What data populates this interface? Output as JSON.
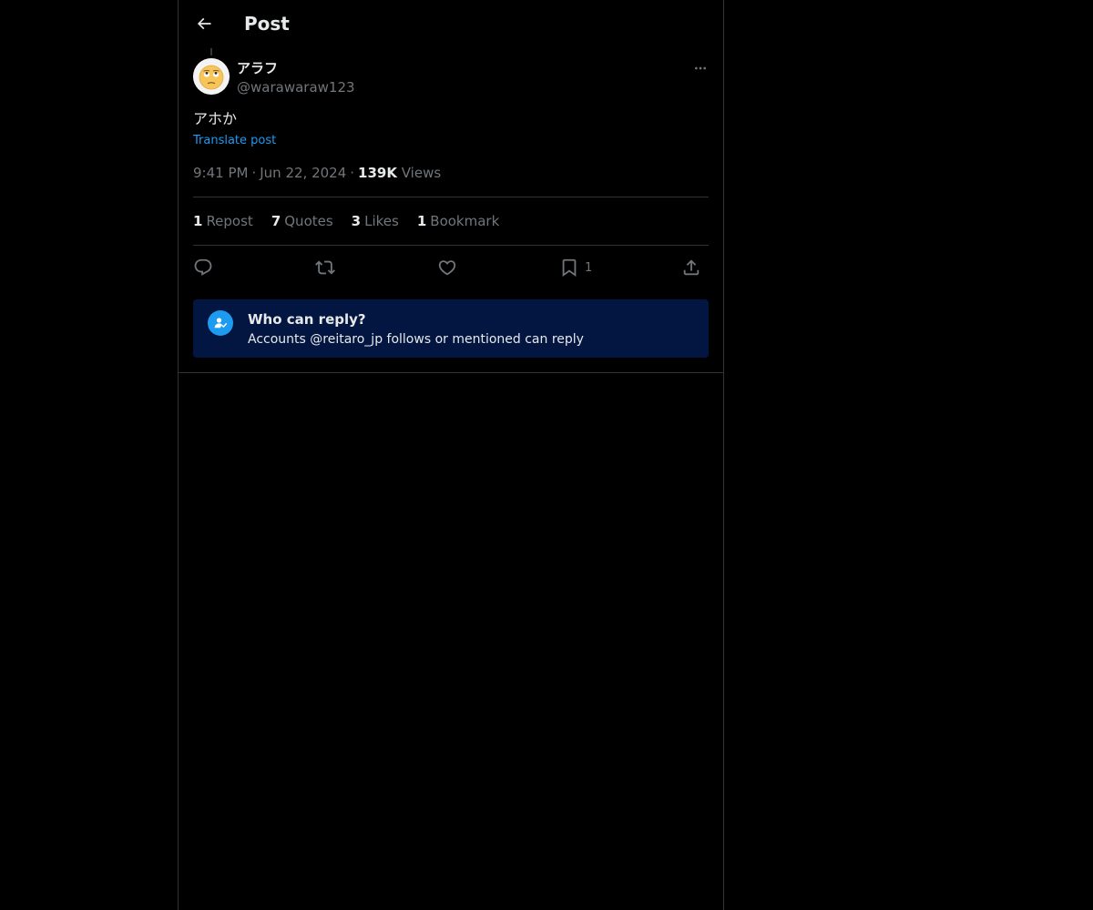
{
  "header": {
    "title": "Post"
  },
  "post": {
    "author": {
      "display_name": "アラフ",
      "handle": "@warawaraw123",
      "avatar_icon": "eye-roll-emoji"
    },
    "text": "アホか",
    "translate_label": "Translate post",
    "time": "9:41 PM",
    "date": "Jun 22, 2024",
    "views_count": "139K",
    "views_label": "Views",
    "separator": "·"
  },
  "stats": {
    "reposts": {
      "count": "1",
      "label": "Repost"
    },
    "quotes": {
      "count": "7",
      "label": "Quotes"
    },
    "likes": {
      "count": "3",
      "label": "Likes"
    },
    "bookmarks": {
      "count": "1",
      "label": "Bookmark"
    }
  },
  "actions": {
    "reply_icon": "reply-icon",
    "repost_icon": "repost-icon",
    "like_icon": "heart-icon",
    "bookmark_icon": "bookmark-icon",
    "bookmark_count": "1",
    "share_icon": "share-icon"
  },
  "reply_restriction": {
    "title": "Who can reply?",
    "description": "Accounts @reitaro_jp follows or mentioned can reply"
  },
  "colors": {
    "background": "#000000",
    "text_primary": "#e7e9ea",
    "text_secondary": "#71767b",
    "accent": "#1d9bf0",
    "reply_box_bg": "#031641",
    "border": "#2f3336"
  }
}
